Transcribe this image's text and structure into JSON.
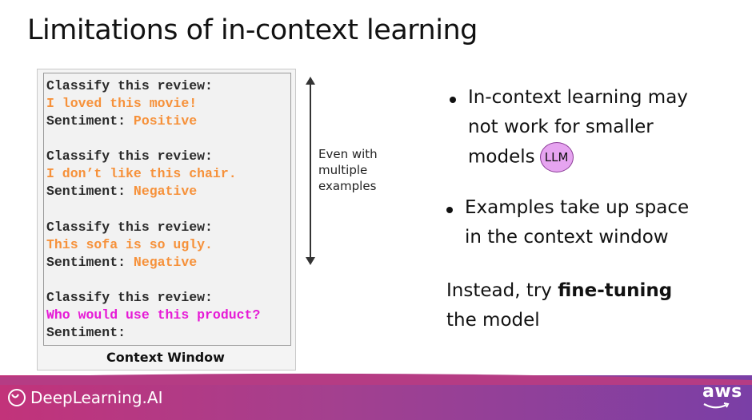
{
  "slide": {
    "title": "Limitations of in-context learning"
  },
  "context_window": {
    "label": "Context Window",
    "lines": [
      {
        "text": "Classify this review:",
        "color": "#2a2a2a"
      },
      {
        "text": "I loved this movie!",
        "color": "#f6913a"
      },
      {
        "text": "Sentiment: ",
        "color": "#2a2a2a",
        "suffix": "Positive",
        "suffix_color": "#f6913a"
      },
      {
        "text": "Classify this review:",
        "color": "#2a2a2a"
      },
      {
        "text": "I don’t like this chair.",
        "color": "#f6913a"
      },
      {
        "text": "Sentiment: ",
        "color": "#2a2a2a",
        "suffix": "Negative",
        "suffix_color": "#f6913a"
      },
      {
        "text": "Classify this review:",
        "color": "#2a2a2a"
      },
      {
        "text": "This sofa is so ugly.",
        "color": "#f6913a"
      },
      {
        "text": "Sentiment: ",
        "color": "#2a2a2a",
        "suffix": "Negative",
        "suffix_color": "#f6913a"
      },
      {
        "text": "Classify this review:",
        "color": "#2a2a2a"
      },
      {
        "text": "Who would use this product?",
        "color": "#e61ad6"
      },
      {
        "text": "Sentiment:",
        "color": "#2a2a2a"
      }
    ]
  },
  "side_note": {
    "line1": "Even with",
    "line2": "multiple",
    "line3": "examples"
  },
  "bullets": {
    "b1_line1": "In-context learning may",
    "b1_line2": "not work for smaller",
    "b1_line3": "models",
    "llm_badge": "LLM",
    "b2_line1": "Examples take up space",
    "b2_line2": "in the context window"
  },
  "instead": {
    "prefix": "Instead, try ",
    "bold": "fine-tuning",
    "line2": "the model"
  },
  "footer": {
    "brand": "DeepLearning.AI",
    "partner": "aws"
  },
  "colors": {
    "orange": "#f6913a",
    "magenta": "#e61ad6",
    "footer_start": "#c2337a",
    "footer_end": "#7a3fa6"
  }
}
